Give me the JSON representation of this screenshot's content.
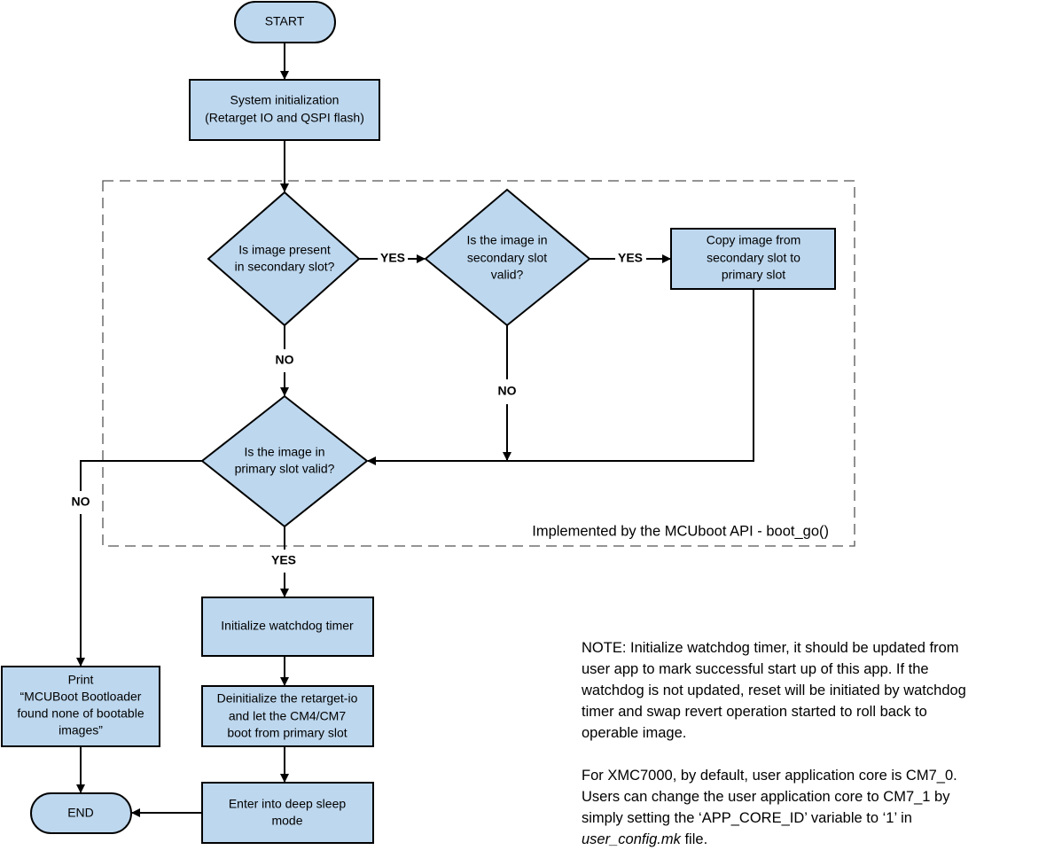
{
  "nodes": {
    "start": "START",
    "sys_init": [
      "System initialization",
      "(Retarget IO and QSPI flash)"
    ],
    "d_secondary_present": [
      "Is image present",
      "in secondary slot?"
    ],
    "d_secondary_valid": [
      "Is the image in",
      "secondary slot",
      "valid?"
    ],
    "copy": [
      "Copy image from",
      "secondary slot to",
      "primary slot"
    ],
    "d_primary_valid": [
      "Is the image in",
      "primary slot valid?"
    ],
    "watchdog": "Initialize watchdog timer",
    "deinit": [
      "Deinitialize the retarget-io",
      "and let the CM4/CM7",
      "boot from primary slot"
    ],
    "deep_sleep": [
      "Enter into deep sleep",
      "mode"
    ],
    "print": [
      "Print",
      "“MCUBoot Bootloader",
      "found none of bootable",
      "images”"
    ],
    "end": "END"
  },
  "edge_labels": {
    "yes1": "YES",
    "yes2": "YES",
    "no1": "NO",
    "no2": "NO",
    "no3": "NO",
    "yes3": "YES"
  },
  "group_label": "Implemented by the MCUboot API - boot_go()",
  "note": {
    "para1": [
      "NOTE: Initialize watchdog timer, it should be updated from",
      "user app to mark successful start up of this app. If the",
      "watchdog is not updated, reset will be initiated by watchdog",
      "timer and swap revert operation started to roll back to",
      "operable image."
    ],
    "para2": [
      "For XMC7000, by default, user application core is CM7_0.",
      "Users can change the user application core to CM7_1 by",
      "simply setting the ‘APP_CORE_ID’ variable to ‘1’ in"
    ],
    "para2_last_italic": "user_config.mk",
    "para2_last_rest": " file."
  },
  "colors": {
    "fill": "#bdd7ee",
    "stroke": "#000000"
  }
}
